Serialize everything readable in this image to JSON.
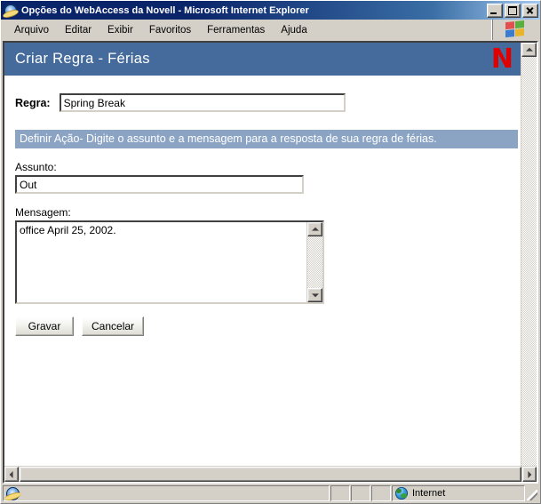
{
  "window": {
    "title": "Opções do WebAccess da Novell - Microsoft Internet Explorer",
    "icon": "ie-icon",
    "controls": {
      "minimize": "minimize-button",
      "maximize": "maximize-button",
      "close": "close-button"
    }
  },
  "menu": {
    "items": [
      {
        "label": "Arquivo"
      },
      {
        "label": "Editar"
      },
      {
        "label": "Exibir"
      },
      {
        "label": "Favoritos"
      },
      {
        "label": "Ferramentas"
      },
      {
        "label": "Ajuda"
      }
    ],
    "logo": "windows-flag-icon"
  },
  "page": {
    "header": {
      "title": "Criar Regra - Férias",
      "logo_text": "N",
      "logo_name": "novell-logo",
      "background_color": "#456a9c",
      "logo_color": "#e00000"
    },
    "rule_field": {
      "label": "Regra:",
      "value": "Spring Break",
      "placeholder": ""
    },
    "instruction": {
      "text": "Definir Ação- Digite o assunto e a mensagem para a resposta de sua regra de férias.",
      "background_color": "#8ca4c4",
      "text_color": "#ffffff"
    },
    "subject_field": {
      "label": "Assunto:",
      "value": "Out",
      "placeholder": ""
    },
    "message_field": {
      "label": "Mensagem:",
      "value": "office April 25, 2002.",
      "placeholder": ""
    },
    "buttons": {
      "save": "Gravar",
      "cancel": "Cancelar"
    }
  },
  "status_bar": {
    "main_text": "",
    "panel_1": "",
    "panel_2": "",
    "panel_3": "",
    "zone_label": "Internet",
    "zone_icon": "globe-icon"
  }
}
